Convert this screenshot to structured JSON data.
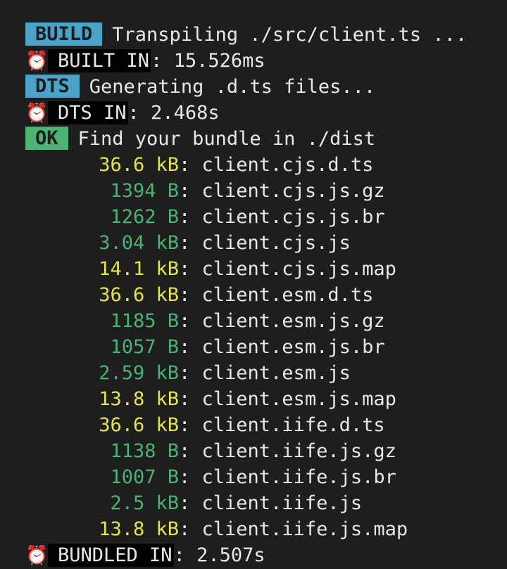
{
  "build": {
    "badge": "BUILD",
    "message": "Transpiling ./src/client.ts ..."
  },
  "built_in": {
    "icon": "alarm-clock-icon",
    "label": "BUILT IN",
    "value": "15.526ms"
  },
  "dts": {
    "badge": "DTS",
    "message": "Generating .d.ts files..."
  },
  "dts_in": {
    "icon": "alarm-clock-icon",
    "label": "DTS IN",
    "value": "2.468s"
  },
  "ok": {
    "badge": "OK",
    "message": "Find your bundle in ./dist"
  },
  "files": [
    {
      "size": "36.6 kB",
      "color": "#e5e34e",
      "name": "client.cjs.d.ts"
    },
    {
      "size": "1394 B",
      "color": "#4db375",
      "name": "client.cjs.js.gz"
    },
    {
      "size": "1262 B",
      "color": "#4db375",
      "name": "client.cjs.js.br"
    },
    {
      "size": "3.04 kB",
      "color": "#4db375",
      "name": "client.cjs.js"
    },
    {
      "size": "14.1 kB",
      "color": "#e5e34e",
      "name": "client.cjs.js.map"
    },
    {
      "size": "36.6 kB",
      "color": "#e5e34e",
      "name": "client.esm.d.ts"
    },
    {
      "size": "1185 B",
      "color": "#4db375",
      "name": "client.esm.js.gz"
    },
    {
      "size": "1057 B",
      "color": "#4db375",
      "name": "client.esm.js.br"
    },
    {
      "size": "2.59 kB",
      "color": "#4db375",
      "name": "client.esm.js"
    },
    {
      "size": "13.8 kB",
      "color": "#e5e34e",
      "name": "client.esm.js.map"
    },
    {
      "size": "36.6 kB",
      "color": "#e5e34e",
      "name": "client.iife.d.ts"
    },
    {
      "size": "1138 B",
      "color": "#4db375",
      "name": "client.iife.js.gz"
    },
    {
      "size": "1007 B",
      "color": "#4db375",
      "name": "client.iife.js.br"
    },
    {
      "size": "2.5 kB",
      "color": "#4db375",
      "name": "client.iife.js"
    },
    {
      "size": "13.8 kB",
      "color": "#e5e34e",
      "name": "client.iife.js.map"
    }
  ],
  "bundled_in": {
    "icon": "alarm-clock-icon",
    "label": "BUNDLED IN",
    "value": "2.507s"
  },
  "separator": ": "
}
